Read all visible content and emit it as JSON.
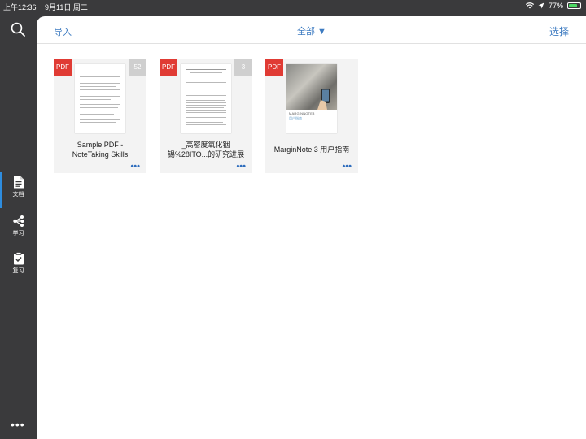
{
  "status": {
    "time": "上午12:36",
    "date": "9月11日 周二",
    "battery": "77%",
    "battery_level": 0.77
  },
  "sidebar": {
    "items": [
      {
        "label": "文档",
        "icon": "document-icon"
      },
      {
        "label": "学习",
        "icon": "mindmap-icon"
      },
      {
        "label": "复习",
        "icon": "clipboard-icon"
      }
    ]
  },
  "toolbar": {
    "import_label": "导入",
    "filter_label": "全部 ▼",
    "select_label": "选择"
  },
  "documents": [
    {
      "badge": "PDF",
      "pages": "52",
      "title_line1": "Sample PDF -",
      "title_line2": "NoteTaking Skills"
    },
    {
      "badge": "PDF",
      "pages": "3",
      "title_line1": "_高密度氧化铟",
      "title_line2": "锡%28ITO...的研究进展"
    },
    {
      "badge": "PDF",
      "title_line1": "MarginNote 3 用户指南",
      "cover_brand": "MARGINNOTE3",
      "cover_sub": "用户指南"
    }
  ],
  "colors": {
    "accent": "#3d7bc1",
    "pdf_badge": "#e03b34",
    "sidebar": "#3a3a3c"
  }
}
